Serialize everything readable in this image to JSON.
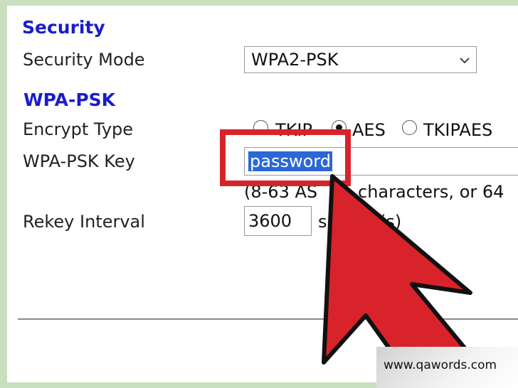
{
  "security": {
    "heading": "Security",
    "mode_label": "Security Mode",
    "mode_value": "WPA2-PSK"
  },
  "wpa_psk": {
    "heading": "WPA-PSK",
    "encrypt_label": "Encrypt Type",
    "encrypt_options": [
      {
        "label": "TKIP",
        "selected": false
      },
      {
        "label": "AES",
        "selected": true
      },
      {
        "label": "TKIPAES",
        "selected": false
      }
    ],
    "key_label": "WPA-PSK Key",
    "key_value": "password",
    "key_hint": "(8-63 AS",
    "key_hint_tail": "characters, or 64",
    "rekey_label": "Rekey Interval",
    "rekey_value": "3600",
    "rekey_unit_head": "s",
    "rekey_unit_tail": "(s)"
  },
  "annotation": {
    "highlight_color": "#d8232a",
    "arrow_color": "#d8232a",
    "selection_color": "#2b67d6"
  },
  "watermark": {
    "text": "www.qawords.com"
  }
}
